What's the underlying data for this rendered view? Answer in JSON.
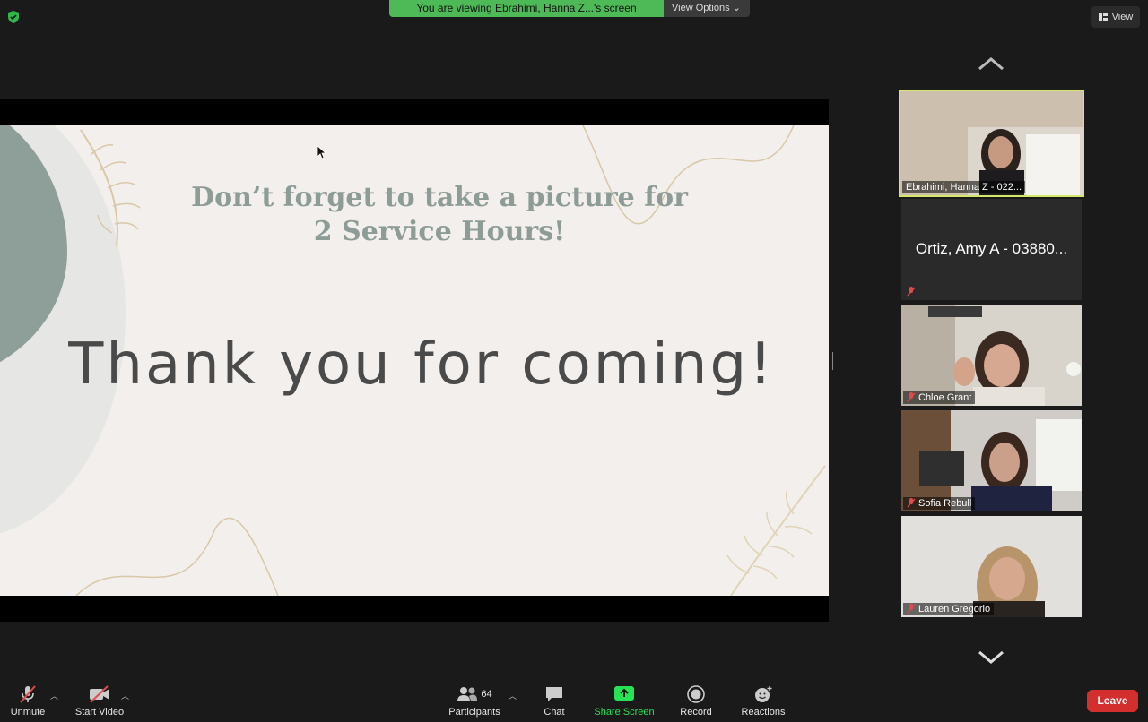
{
  "banner": {
    "text": "You are viewing Ebrahimi, Hanna Z...'s screen",
    "view_options": "View Options"
  },
  "view_button": "View",
  "slide": {
    "subtitle_line1": "Don’t forget to take a picture for",
    "subtitle_line2": "2 Service Hours!",
    "headline": "Thank you for coming!"
  },
  "participants": [
    {
      "name": "Ebrahimi, Hanna Z - 022...",
      "active": true,
      "muted": false
    },
    {
      "name": "Ortiz, Amy A - 03880...",
      "video_off": true,
      "muted": true
    },
    {
      "name": "Chloe Grant",
      "muted": true
    },
    {
      "name": "Sofia Rebull",
      "muted": true
    },
    {
      "name": "Lauren Gregorio",
      "muted": true
    }
  ],
  "toolbar": {
    "unmute": "Unmute",
    "start_video": "Start Video",
    "participants": "Participants",
    "participants_count": "64",
    "chat": "Chat",
    "share_screen": "Share Screen",
    "record": "Record",
    "reactions": "Reactions",
    "leave": "Leave"
  },
  "colors": {
    "banner": "#4dba57",
    "active_border": "#d6e66a",
    "leave": "#d32f2f",
    "share": "#27e255"
  }
}
